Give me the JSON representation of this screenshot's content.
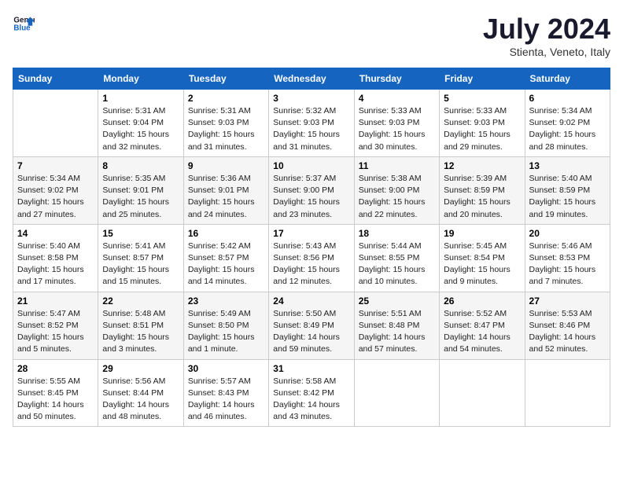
{
  "header": {
    "logo_line1": "General",
    "logo_line2": "Blue",
    "title": "July 2024",
    "subtitle": "Stienta, Veneto, Italy"
  },
  "days_of_week": [
    "Sunday",
    "Monday",
    "Tuesday",
    "Wednesday",
    "Thursday",
    "Friday",
    "Saturday"
  ],
  "weeks": [
    [
      {
        "day": "",
        "info": ""
      },
      {
        "day": "1",
        "info": "Sunrise: 5:31 AM\nSunset: 9:04 PM\nDaylight: 15 hours\nand 32 minutes."
      },
      {
        "day": "2",
        "info": "Sunrise: 5:31 AM\nSunset: 9:03 PM\nDaylight: 15 hours\nand 31 minutes."
      },
      {
        "day": "3",
        "info": "Sunrise: 5:32 AM\nSunset: 9:03 PM\nDaylight: 15 hours\nand 31 minutes."
      },
      {
        "day": "4",
        "info": "Sunrise: 5:33 AM\nSunset: 9:03 PM\nDaylight: 15 hours\nand 30 minutes."
      },
      {
        "day": "5",
        "info": "Sunrise: 5:33 AM\nSunset: 9:03 PM\nDaylight: 15 hours\nand 29 minutes."
      },
      {
        "day": "6",
        "info": "Sunrise: 5:34 AM\nSunset: 9:02 PM\nDaylight: 15 hours\nand 28 minutes."
      }
    ],
    [
      {
        "day": "7",
        "info": "Sunrise: 5:34 AM\nSunset: 9:02 PM\nDaylight: 15 hours\nand 27 minutes."
      },
      {
        "day": "8",
        "info": "Sunrise: 5:35 AM\nSunset: 9:01 PM\nDaylight: 15 hours\nand 25 minutes."
      },
      {
        "day": "9",
        "info": "Sunrise: 5:36 AM\nSunset: 9:01 PM\nDaylight: 15 hours\nand 24 minutes."
      },
      {
        "day": "10",
        "info": "Sunrise: 5:37 AM\nSunset: 9:00 PM\nDaylight: 15 hours\nand 23 minutes."
      },
      {
        "day": "11",
        "info": "Sunrise: 5:38 AM\nSunset: 9:00 PM\nDaylight: 15 hours\nand 22 minutes."
      },
      {
        "day": "12",
        "info": "Sunrise: 5:39 AM\nSunset: 8:59 PM\nDaylight: 15 hours\nand 20 minutes."
      },
      {
        "day": "13",
        "info": "Sunrise: 5:40 AM\nSunset: 8:59 PM\nDaylight: 15 hours\nand 19 minutes."
      }
    ],
    [
      {
        "day": "14",
        "info": "Sunrise: 5:40 AM\nSunset: 8:58 PM\nDaylight: 15 hours\nand 17 minutes."
      },
      {
        "day": "15",
        "info": "Sunrise: 5:41 AM\nSunset: 8:57 PM\nDaylight: 15 hours\nand 15 minutes."
      },
      {
        "day": "16",
        "info": "Sunrise: 5:42 AM\nSunset: 8:57 PM\nDaylight: 15 hours\nand 14 minutes."
      },
      {
        "day": "17",
        "info": "Sunrise: 5:43 AM\nSunset: 8:56 PM\nDaylight: 15 hours\nand 12 minutes."
      },
      {
        "day": "18",
        "info": "Sunrise: 5:44 AM\nSunset: 8:55 PM\nDaylight: 15 hours\nand 10 minutes."
      },
      {
        "day": "19",
        "info": "Sunrise: 5:45 AM\nSunset: 8:54 PM\nDaylight: 15 hours\nand 9 minutes."
      },
      {
        "day": "20",
        "info": "Sunrise: 5:46 AM\nSunset: 8:53 PM\nDaylight: 15 hours\nand 7 minutes."
      }
    ],
    [
      {
        "day": "21",
        "info": "Sunrise: 5:47 AM\nSunset: 8:52 PM\nDaylight: 15 hours\nand 5 minutes."
      },
      {
        "day": "22",
        "info": "Sunrise: 5:48 AM\nSunset: 8:51 PM\nDaylight: 15 hours\nand 3 minutes."
      },
      {
        "day": "23",
        "info": "Sunrise: 5:49 AM\nSunset: 8:50 PM\nDaylight: 15 hours\nand 1 minute."
      },
      {
        "day": "24",
        "info": "Sunrise: 5:50 AM\nSunset: 8:49 PM\nDaylight: 14 hours\nand 59 minutes."
      },
      {
        "day": "25",
        "info": "Sunrise: 5:51 AM\nSunset: 8:48 PM\nDaylight: 14 hours\nand 57 minutes."
      },
      {
        "day": "26",
        "info": "Sunrise: 5:52 AM\nSunset: 8:47 PM\nDaylight: 14 hours\nand 54 minutes."
      },
      {
        "day": "27",
        "info": "Sunrise: 5:53 AM\nSunset: 8:46 PM\nDaylight: 14 hours\nand 52 minutes."
      }
    ],
    [
      {
        "day": "28",
        "info": "Sunrise: 5:55 AM\nSunset: 8:45 PM\nDaylight: 14 hours\nand 50 minutes."
      },
      {
        "day": "29",
        "info": "Sunrise: 5:56 AM\nSunset: 8:44 PM\nDaylight: 14 hours\nand 48 minutes."
      },
      {
        "day": "30",
        "info": "Sunrise: 5:57 AM\nSunset: 8:43 PM\nDaylight: 14 hours\nand 46 minutes."
      },
      {
        "day": "31",
        "info": "Sunrise: 5:58 AM\nSunset: 8:42 PM\nDaylight: 14 hours\nand 43 minutes."
      },
      {
        "day": "",
        "info": ""
      },
      {
        "day": "",
        "info": ""
      },
      {
        "day": "",
        "info": ""
      }
    ]
  ]
}
